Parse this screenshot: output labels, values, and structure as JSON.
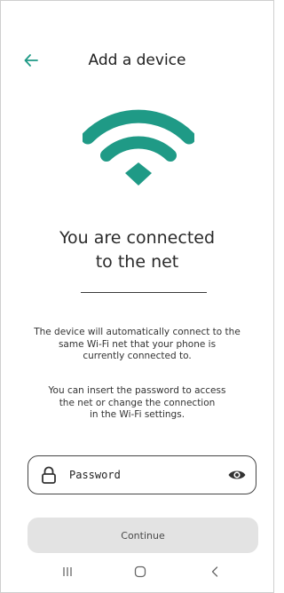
{
  "header": {
    "title": "Add a device",
    "back_icon": "arrow-left-icon"
  },
  "hero": {
    "icon": "wifi-icon",
    "headline_line1": "You are connected",
    "headline_line2": "to the net"
  },
  "info": {
    "p1_line1": "The device will automatically connect to the",
    "p1_line2": "same Wi-Fi net that your phone is",
    "p1_line3": "currently connected to.",
    "p2_line1": "You can insert the password to access",
    "p2_line2": "the net or change the connection",
    "p2_line3": "in the Wi-Fi settings."
  },
  "password": {
    "placeholder": "Password",
    "value": "",
    "lock_icon": "lock-icon",
    "eye_icon": "eye-icon"
  },
  "actions": {
    "continue_label": "Continue"
  },
  "system_nav": {
    "recents_icon": "recents-icon",
    "home_icon": "home-icon",
    "back_icon": "nav-back-icon"
  },
  "colors": {
    "accent": "#1f9a86",
    "button_bg": "#e3e3e3"
  }
}
